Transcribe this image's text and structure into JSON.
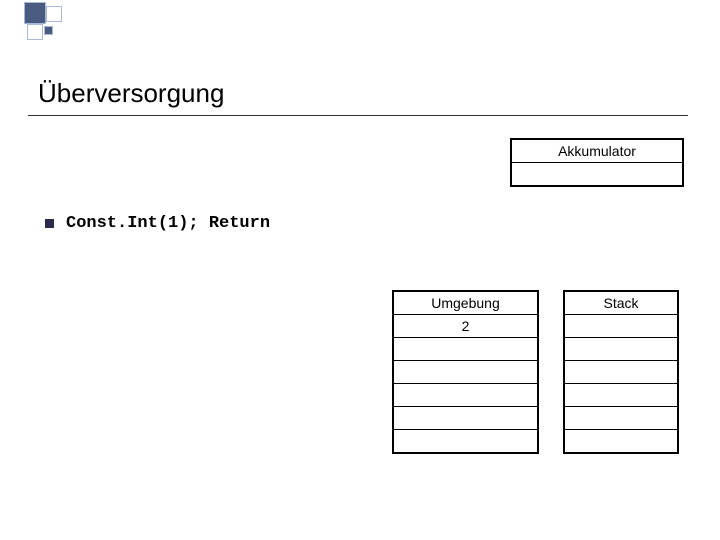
{
  "title": "Überversorgung",
  "accumulator": {
    "label": "Akkumulator",
    "value": ""
  },
  "bullet_code": "Const.Int(1); Return",
  "env_table": {
    "label": "Umgebung",
    "rows": [
      "2",
      "",
      "",
      "",
      "",
      ""
    ]
  },
  "stack_table": {
    "label": "Stack",
    "rows": [
      "",
      "",
      "",
      "",
      "",
      ""
    ]
  }
}
